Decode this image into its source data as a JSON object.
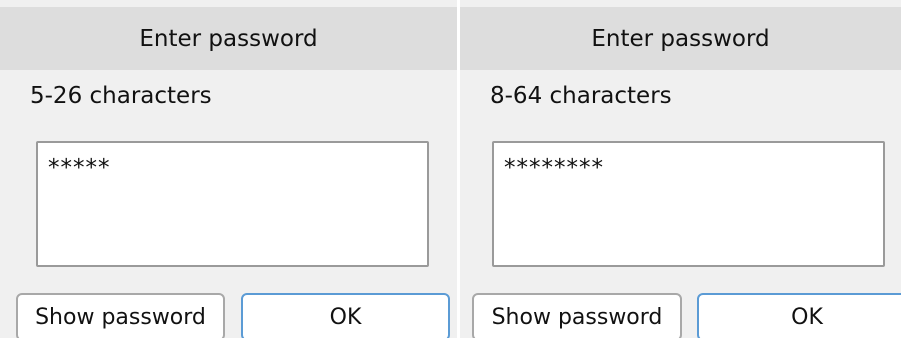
{
  "screens": [
    {
      "title": "Enter password",
      "hint": "5-26 characters",
      "password_value": "*****",
      "show_password_label": "Show password",
      "ok_label": "OK"
    },
    {
      "title": "Enter password",
      "hint": "8-64 characters",
      "password_value": "********",
      "show_password_label": "Show password",
      "ok_label": "OK"
    }
  ],
  "colors": {
    "screen_background": "#f0f0f0",
    "title_bar": "#dddddd",
    "field_border": "#9a9a9a",
    "ok_button_border": "#5b9bd5"
  }
}
